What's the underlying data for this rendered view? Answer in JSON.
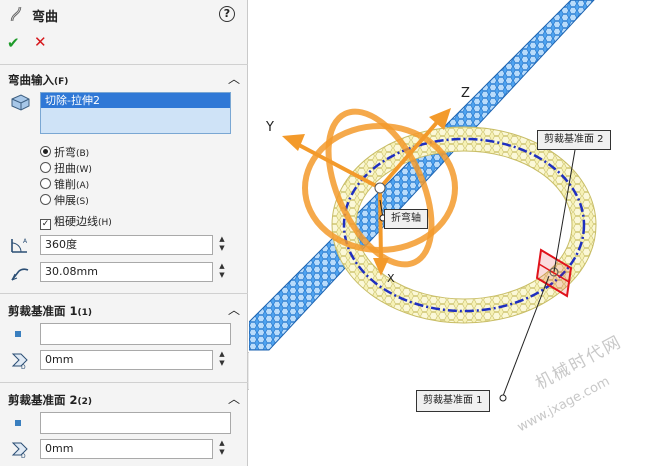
{
  "header": {
    "title": "弯曲",
    "help": "?"
  },
  "actions": {
    "ok": "✔",
    "cancel": "✕"
  },
  "bend_input": {
    "section_label": "弯曲输入",
    "section_hint": "(F)",
    "selected_body": "切除-拉伸2",
    "options": [
      {
        "label": "折弯",
        "hint": "(B)",
        "selected": true
      },
      {
        "label": "扭曲",
        "hint": "(W)",
        "selected": false
      },
      {
        "label": "锥削",
        "hint": "(A)",
        "selected": false
      },
      {
        "label": "伸展",
        "hint": "(S)",
        "selected": false
      }
    ],
    "rigid_edges_label": "粗硬边线",
    "rigid_edges_hint": "(H)",
    "angle_value": "360度",
    "radius_value": "30.08mm"
  },
  "trim_plane_1": {
    "section_label": "剪裁基准面 1",
    "section_hint": "(1)",
    "distance_value": "0mm"
  },
  "trim_plane_2": {
    "section_label": "剪裁基准面 2",
    "section_hint": "(2)",
    "distance_value": "0mm"
  },
  "viewport": {
    "callouts": {
      "trim_plane_2": "剪裁基准面 2",
      "bend_axis": "折弯轴",
      "trim_plane_1": "剪裁基准面 1"
    },
    "axes": {
      "x": "X",
      "y": "Y",
      "z": "Z"
    },
    "watermark": {
      "line1": "机械时代网",
      "line2": "www.jxage.com"
    }
  },
  "colors": {
    "ok": "#1e9b2a",
    "cancel": "#d6161b",
    "selection": "#2f78d6",
    "triad": "#f39a2b",
    "tube": "#3b8ee6",
    "ring": "#f3eda2",
    "centerline": "#1f2fc0",
    "trim_plane": "#e0131b"
  }
}
